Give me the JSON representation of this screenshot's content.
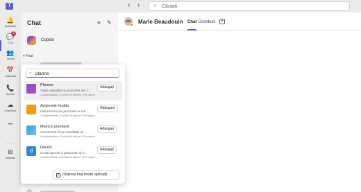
{
  "topbar": {
    "logo": "T",
    "back_glyph": "‹",
    "forward_glyph": "›",
    "search_placeholder": "Căutați",
    "search_icon": "search-icon"
  },
  "rail": {
    "items": [
      {
        "label": "Activitate",
        "icon": "bell-icon",
        "glyph": "🔔"
      },
      {
        "label": "Chat",
        "icon": "chat-icon",
        "glyph": "💬"
      },
      {
        "label": "Teams",
        "icon": "teams-icon",
        "glyph": "👥"
      },
      {
        "label": "Calendar",
        "icon": "calendar-icon",
        "glyph": "📅"
      },
      {
        "label": "Apeluri",
        "icon": "phone-icon",
        "glyph": "📞"
      },
      {
        "label": "OneDrive",
        "icon": "cloud-icon",
        "glyph": "☁"
      },
      {
        "label": "",
        "icon": "more-icon",
        "glyph": "•••"
      },
      {
        "label": "Aplicații",
        "icon": "apps-icon",
        "glyph": "⊞"
      }
    ],
    "chat_badge": "2"
  },
  "chat_panel": {
    "title": "Chat",
    "filter_icon": "≡",
    "compose_icon": "✎",
    "copilot_label": "Copilot",
    "pinned_label": "▾ Fixat"
  },
  "main": {
    "avatar_initials": "MB",
    "user_name": "Marle Beaudouin",
    "tabs": [
      "Chat",
      "Distribuit"
    ],
    "add_tab": "+"
  },
  "app_picker": {
    "search_value": "planne",
    "apps": [
      {
        "name": "Planner",
        "description": "Toate activitățile și proiectele dvs. î...",
        "meta": "Confidențialitate | Condiții de utilizare | Permisiuni",
        "button": "Adăugați",
        "color": "#7b4fd8"
      },
      {
        "name": "Avizierele Huddo",
        "description": "Instrumentul de gestionare a acti...",
        "meta": "Confidențialitate | Condiții de utilizare | Permisiuni",
        "button": "Adăugare",
        "color": "#f39c12"
      },
      {
        "name": "Matrice prioritară",
        "description": "Concentrați-vă pe activitățile de ...",
        "meta": "Confidențialitate | Condiții de utilizare | Permisiuni",
        "button": "Adăugați",
        "color": "#2fa0e0"
      },
      {
        "name": "Decizii",
        "description": "Creați agende și gestionați-vă m...",
        "meta": "Confidențialitate | Condiții de utilizare | Permisiuni",
        "button": "Adăugați",
        "color": "#2b88d8"
      }
    ],
    "more_apps_label": "Obțineți mai multe aplicații"
  }
}
